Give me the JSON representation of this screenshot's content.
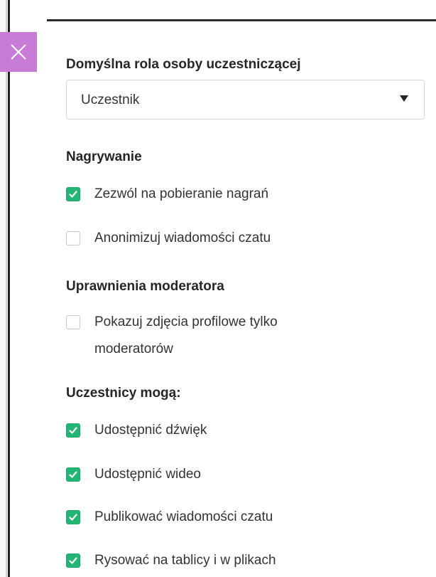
{
  "panel": {
    "default_role": {
      "heading": "Domyślna rola osoby uczestniczącej",
      "selected_value": "Uczestnik"
    },
    "recording": {
      "heading": "Nagrywanie",
      "options": [
        {
          "label": "Zezwól na pobieranie nagrań",
          "checked": true
        },
        {
          "label": "Anonimizuj wiadomości czatu",
          "checked": false
        }
      ]
    },
    "moderator": {
      "heading": "Uprawnienia moderatora",
      "options": [
        {
          "label": "Pokazuj zdjęcia profilowe tylko moderatorów",
          "checked": false
        }
      ]
    },
    "participants": {
      "heading": "Uczestnicy mogą:",
      "options": [
        {
          "label": "Udostępnić dźwięk",
          "checked": true
        },
        {
          "label": "Udostępnić wideo",
          "checked": true
        },
        {
          "label": "Publikować wiadomości czatu",
          "checked": true
        },
        {
          "label": "Rysować na tablicy i w plikach",
          "checked": true
        }
      ]
    }
  },
  "icons": {
    "close": "close-icon",
    "checkmark": "checkmark-icon",
    "dropdown": "caret-down-icon"
  },
  "colors": {
    "accent_tab": "#c77ad6",
    "checkbox_checked": "#22b573",
    "text": "#262626"
  }
}
